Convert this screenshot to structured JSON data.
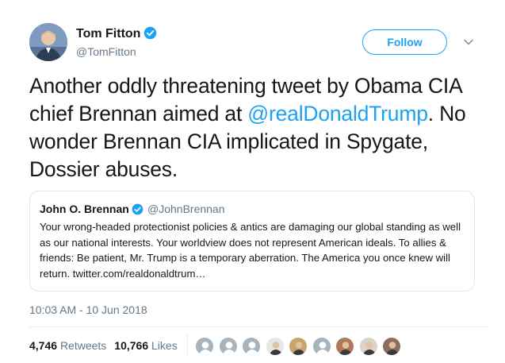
{
  "author": {
    "name": "Tom Fitton",
    "handle": "@TomFitton",
    "verified": true,
    "avatar_icon": "user-avatar-photo"
  },
  "follow_label": "Follow",
  "tweet": {
    "text_before": "Another oddly threatening tweet by Obama CIA chief Brennan aimed at ",
    "mention": "@realDonaldTrump",
    "text_after": ". No wonder Brennan CIA implicated in Spygate, Dossier abuses."
  },
  "quoted": {
    "name": "John O. Brennan",
    "handle": "@JohnBrennan",
    "verified": true,
    "text": "Your wrong-headed protectionist policies & antics are damaging our global standing as well as our national interests. Your worldview does not represent American ideals. To allies & friends: Be patient, Mr. Trump is a temporary aberration. The America you once knew will return. twitter.com/realdonaldtrum…"
  },
  "timestamp": "10:03 AM - 10 Jun 2018",
  "stats": {
    "retweets_count": "4,746",
    "retweets_label": "Retweets",
    "likes_count": "10,766",
    "likes_label": "Likes"
  },
  "likers": [
    {
      "kind": "default-egg",
      "bg": "#a7b3bd"
    },
    {
      "kind": "default-egg",
      "bg": "#a7b3bd"
    },
    {
      "kind": "default-egg",
      "bg": "#a7b3bd"
    },
    {
      "kind": "photo",
      "bg": "#e6e6e6"
    },
    {
      "kind": "photo",
      "bg": "#c9a36a"
    },
    {
      "kind": "default-egg",
      "bg": "#a7b3bd"
    },
    {
      "kind": "photo",
      "bg": "#b07a5a"
    },
    {
      "kind": "photo",
      "bg": "#d9d3cc"
    },
    {
      "kind": "photo",
      "bg": "#8b6e62"
    }
  ],
  "colors": {
    "accent": "#1da1f2",
    "secondary_text": "#657786",
    "primary_text": "#14171a",
    "border": "#e1e8ed"
  }
}
